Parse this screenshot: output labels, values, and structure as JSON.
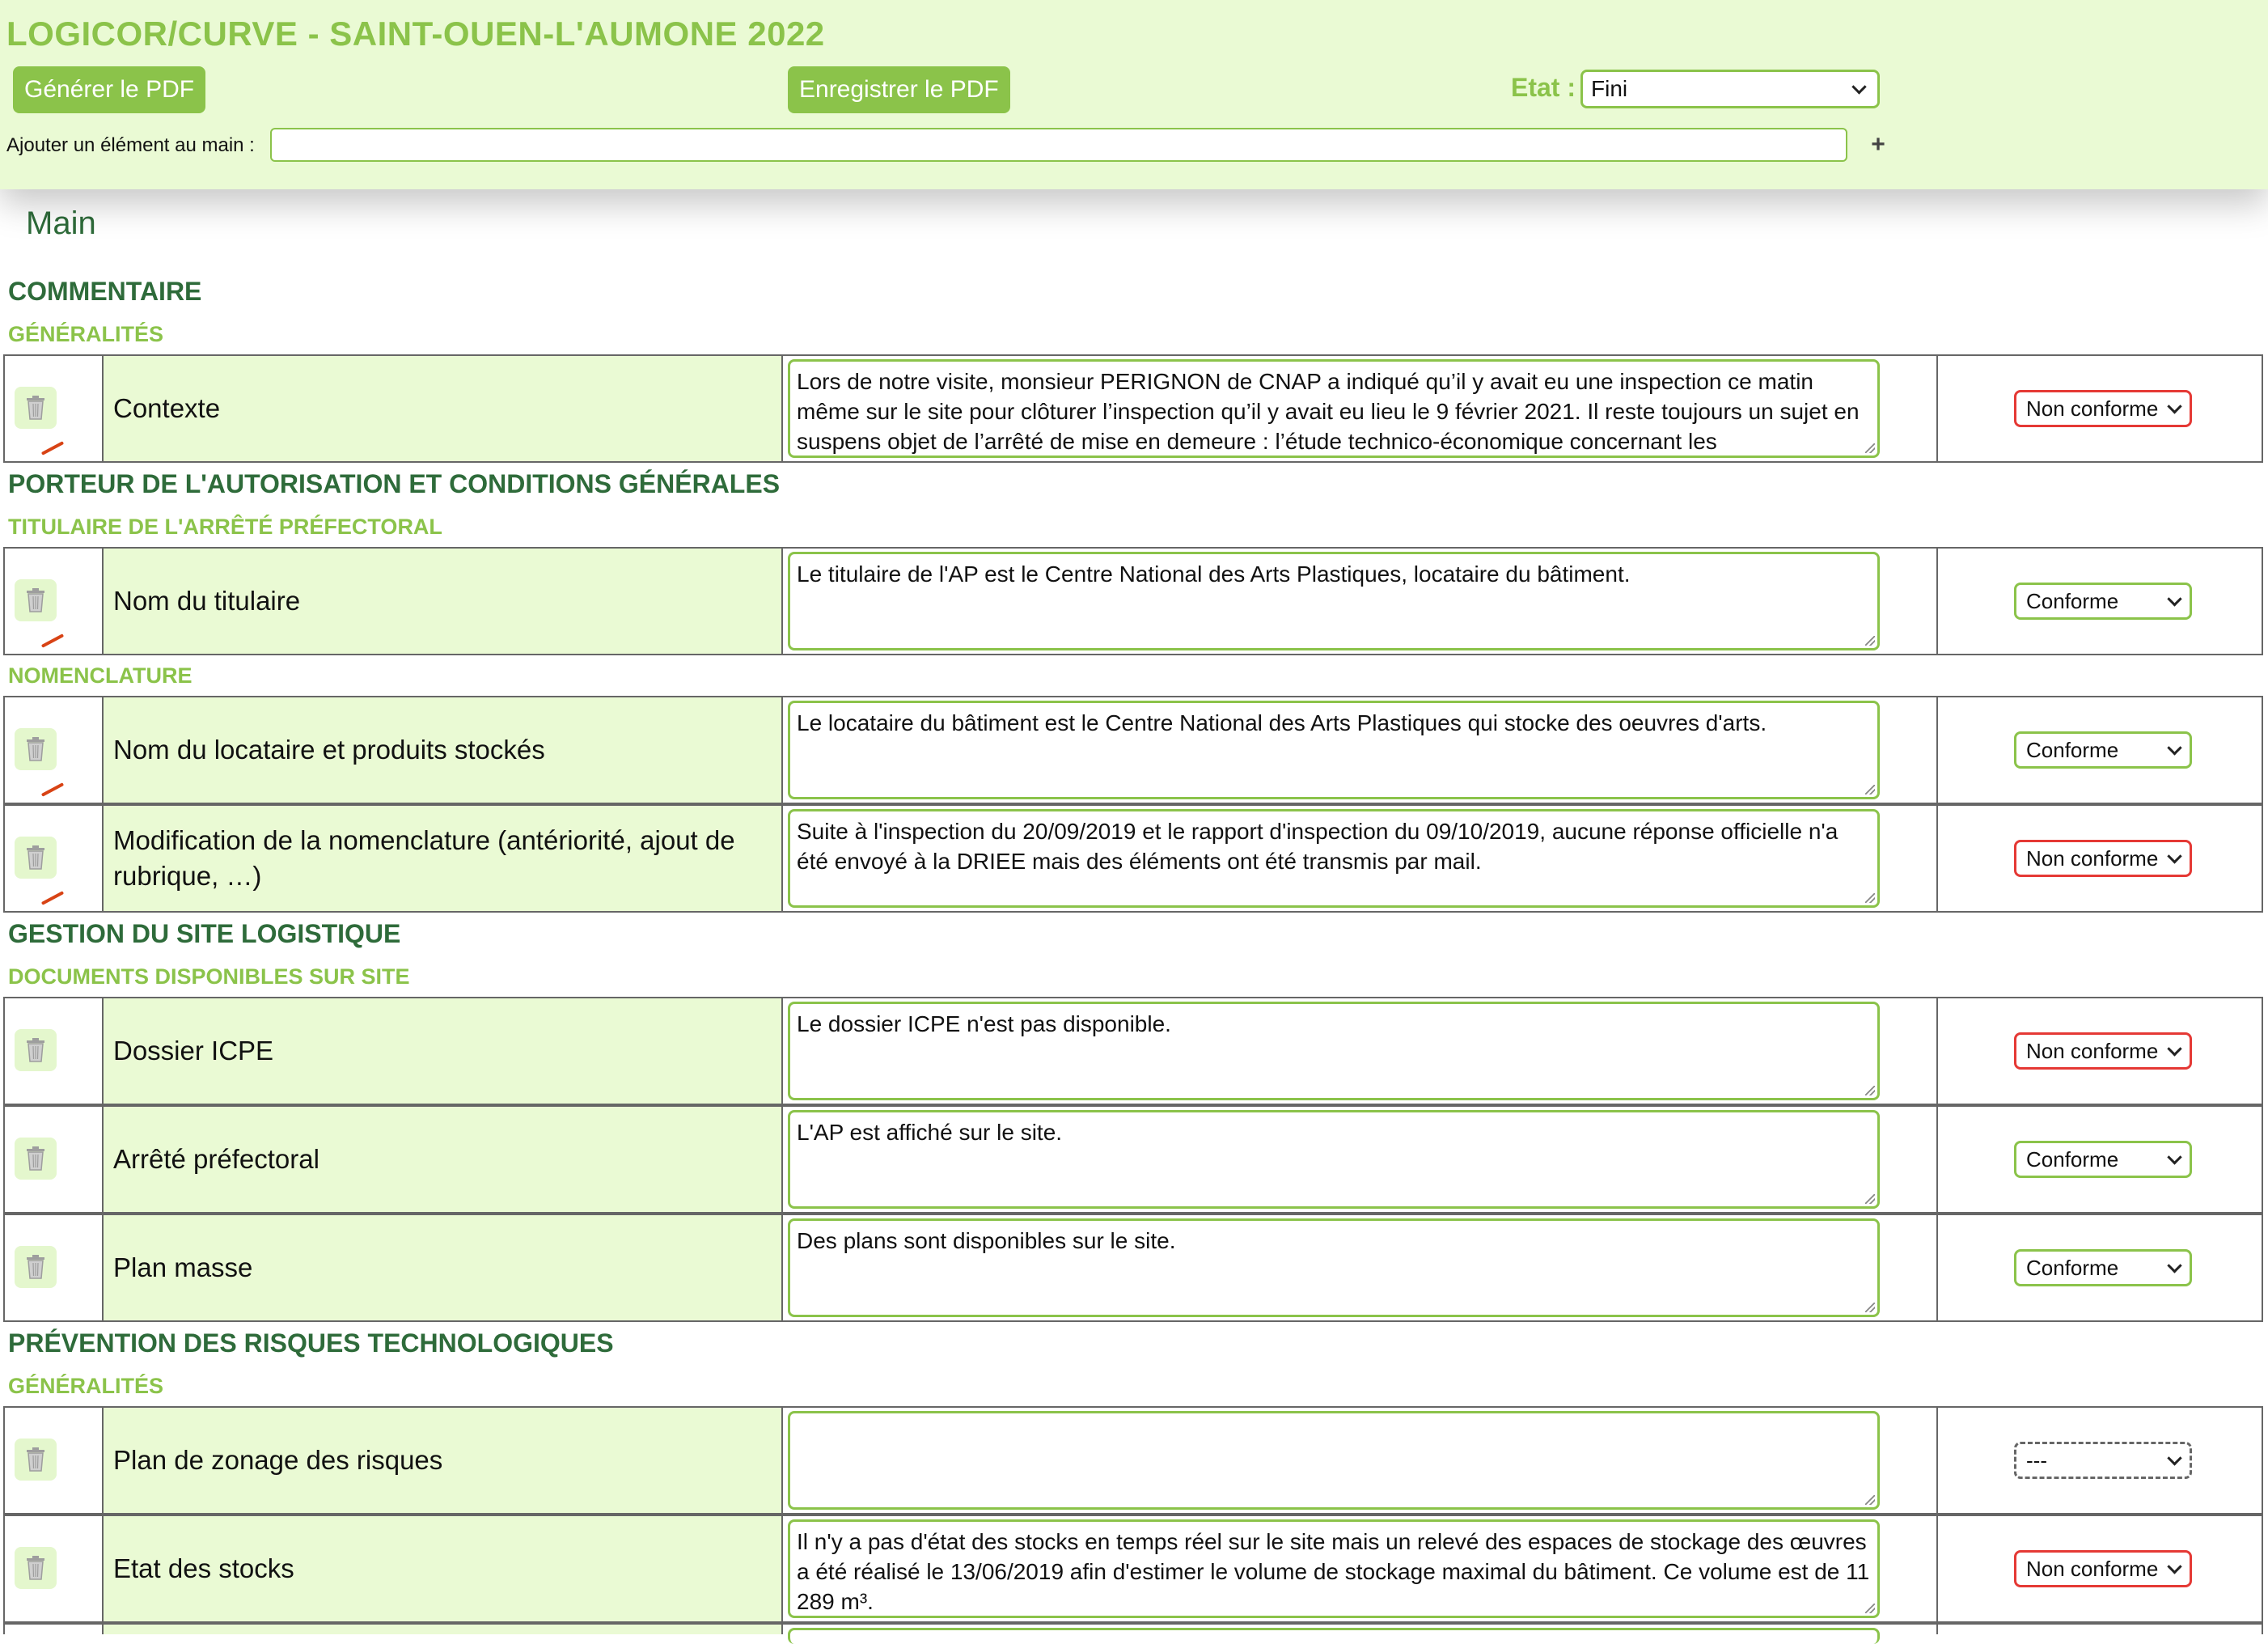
{
  "header": {
    "title": "LOGICOR/CURVE - SAINT-OUEN-L'AUMONE 2022",
    "generate_pdf_label": "Générer le PDF",
    "save_pdf_label": "Enregistrer le PDF",
    "state_label": "Etat :",
    "state_value": "Fini",
    "add_label": "Ajouter un élément au main :",
    "add_value": "",
    "add_button": "+"
  },
  "main": {
    "title": "Main",
    "sections": [
      {
        "title": "COMMENTAIRE"
      },
      {
        "title": "PORTEUR DE L'AUTORISATION ET CONDITIONS GÉNÉRALES"
      },
      {
        "title": "GESTION DU SITE LOGISTIQUE"
      },
      {
        "title": "PRÉVENTION DES RISQUES TECHNOLOGIQUES"
      }
    ],
    "subsections": [
      {
        "title": "GÉNÉRALITÉS"
      },
      {
        "title": "TITULAIRE DE L'ARRÊTÉ PRÉFECTORAL"
      },
      {
        "title": "NOMENCLATURE"
      },
      {
        "title": "DOCUMENTS DISPONIBLES SUR SITE"
      },
      {
        "title": "GÉNÉRALITÉS"
      }
    ],
    "rows": [
      {
        "label": "Contexte",
        "text": "Lors de notre visite, monsieur PERIGNON de CNAP a indiqué qu’il y avait eu une inspection ce matin même sur le site pour clôturer l’inspection qu’il y avait eu lieu le 9 février 2021. Il reste toujours un sujet en suspens objet de l’arrêté de mise en demeure : l’étude technico-économique concernant les",
        "status": "Non conforme"
      },
      {
        "label": "Nom du titulaire",
        "text": "Le titulaire de l'AP est le Centre National des Arts Plastiques, locataire du bâtiment.",
        "status": "Conforme"
      },
      {
        "label": "Nom du locataire et produits stockés",
        "text": "Le locataire du bâtiment est le Centre National des Arts Plastiques qui stocke des oeuvres d'arts.",
        "status": "Conforme"
      },
      {
        "label": "Modification de la nomenclature (antériorité, ajout de rubrique, …)",
        "text": "Suite à l'inspection du 20/09/2019 et le rapport d'inspection du 09/10/2019, aucune réponse officielle n'a été envoyé à la DRIEE mais des éléments ont été transmis par mail.",
        "status": "Non conforme"
      },
      {
        "label": "Dossier ICPE",
        "text": "Le dossier ICPE n'est pas disponible.",
        "status": "Non conforme"
      },
      {
        "label": "Arrêté préfectoral",
        "text": "L'AP est affiché sur le site.",
        "status": "Conforme"
      },
      {
        "label": "Plan masse",
        "text": "Des plans sont disponibles sur le site.",
        "status": "Conforme"
      },
      {
        "label": "Plan de zonage des risques",
        "text": "",
        "status": "---"
      },
      {
        "label": "Etat des stocks",
        "text": "Il n'y a pas d'état des stocks en temps réel sur le site mais un relevé des espaces de stockage des œuvres a été réalisé le 13/06/2019 afin d'estimer le volume de stockage maximal du bâtiment. Ce volume est de 11 289 m³.",
        "status": "Non conforme"
      },
      {
        "label": "",
        "text": "",
        "status": ""
      }
    ]
  },
  "colors": {
    "accent_green": "#8bc34a",
    "header_bg": "#eafad4",
    "dark_green": "#2e6b3a",
    "non_conforme_red": "#e53935"
  }
}
